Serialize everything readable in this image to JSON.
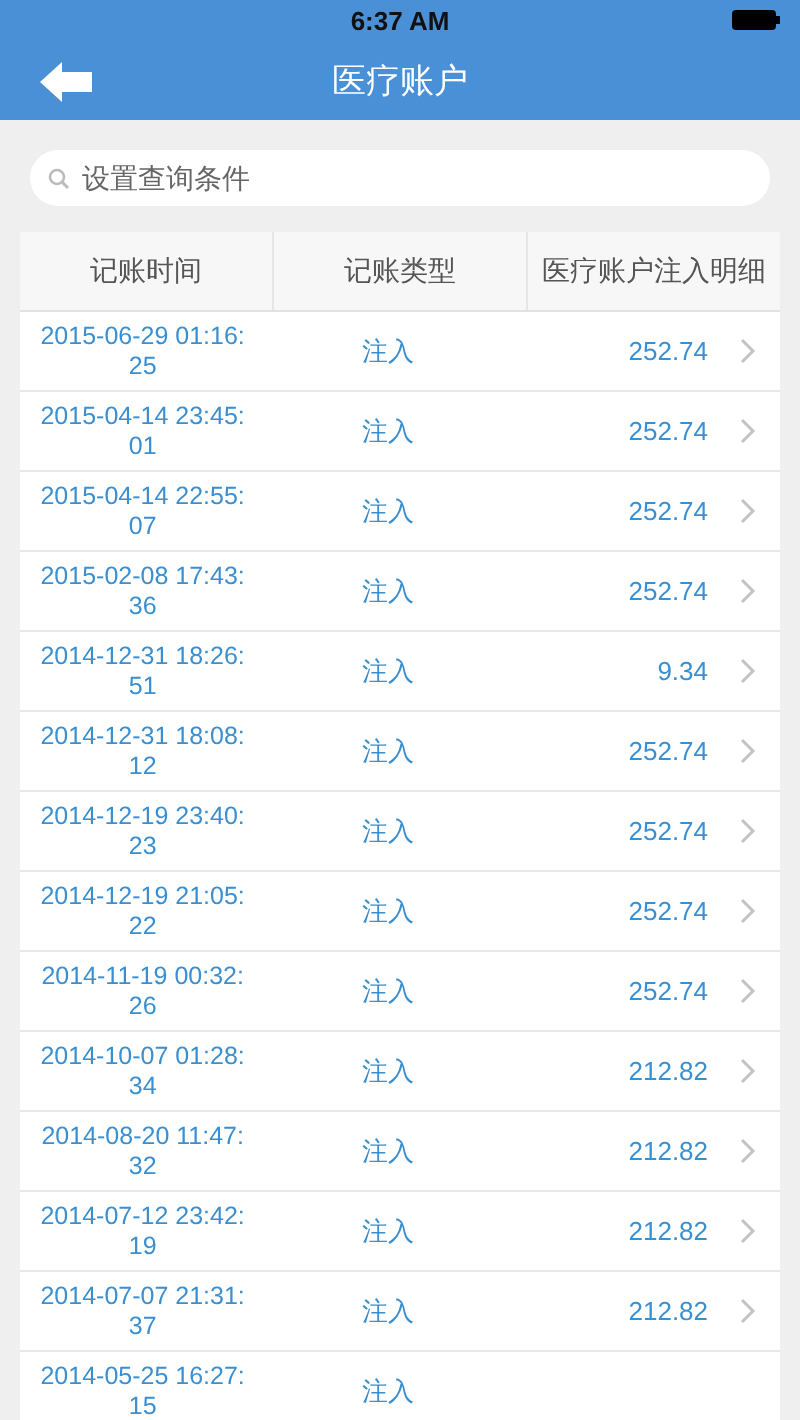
{
  "status_bar": {
    "time": "6:37 AM"
  },
  "nav": {
    "title": "医疗账户"
  },
  "search": {
    "placeholder": "设置查询条件"
  },
  "table": {
    "columns": [
      "记账时间",
      "记账类型",
      "医疗账户注入明细"
    ],
    "rows": [
      {
        "time": "2015-06-29 01:16:25",
        "type": "注入",
        "amount": "252.74"
      },
      {
        "time": "2015-04-14 23:45:01",
        "type": "注入",
        "amount": "252.74"
      },
      {
        "time": "2015-04-14 22:55:07",
        "type": "注入",
        "amount": "252.74"
      },
      {
        "time": "2015-02-08 17:43:36",
        "type": "注入",
        "amount": "252.74"
      },
      {
        "time": "2014-12-31 18:26:51",
        "type": "注入",
        "amount": "9.34"
      },
      {
        "time": "2014-12-31 18:08:12",
        "type": "注入",
        "amount": "252.74"
      },
      {
        "time": "2014-12-19 23:40:23",
        "type": "注入",
        "amount": "252.74"
      },
      {
        "time": "2014-12-19 21:05:22",
        "type": "注入",
        "amount": "252.74"
      },
      {
        "time": "2014-11-19 00:32:26",
        "type": "注入",
        "amount": "252.74"
      },
      {
        "time": "2014-10-07 01:28:34",
        "type": "注入",
        "amount": "212.82"
      },
      {
        "time": "2014-08-20 11:47:32",
        "type": "注入",
        "amount": "212.82"
      },
      {
        "time": "2014-07-12 23:42:19",
        "type": "注入",
        "amount": "212.82"
      },
      {
        "time": "2014-07-07 21:31:37",
        "type": "注入",
        "amount": "212.82"
      },
      {
        "time": "2014-05-25 16:27:15",
        "type": "注入"
      }
    ]
  }
}
